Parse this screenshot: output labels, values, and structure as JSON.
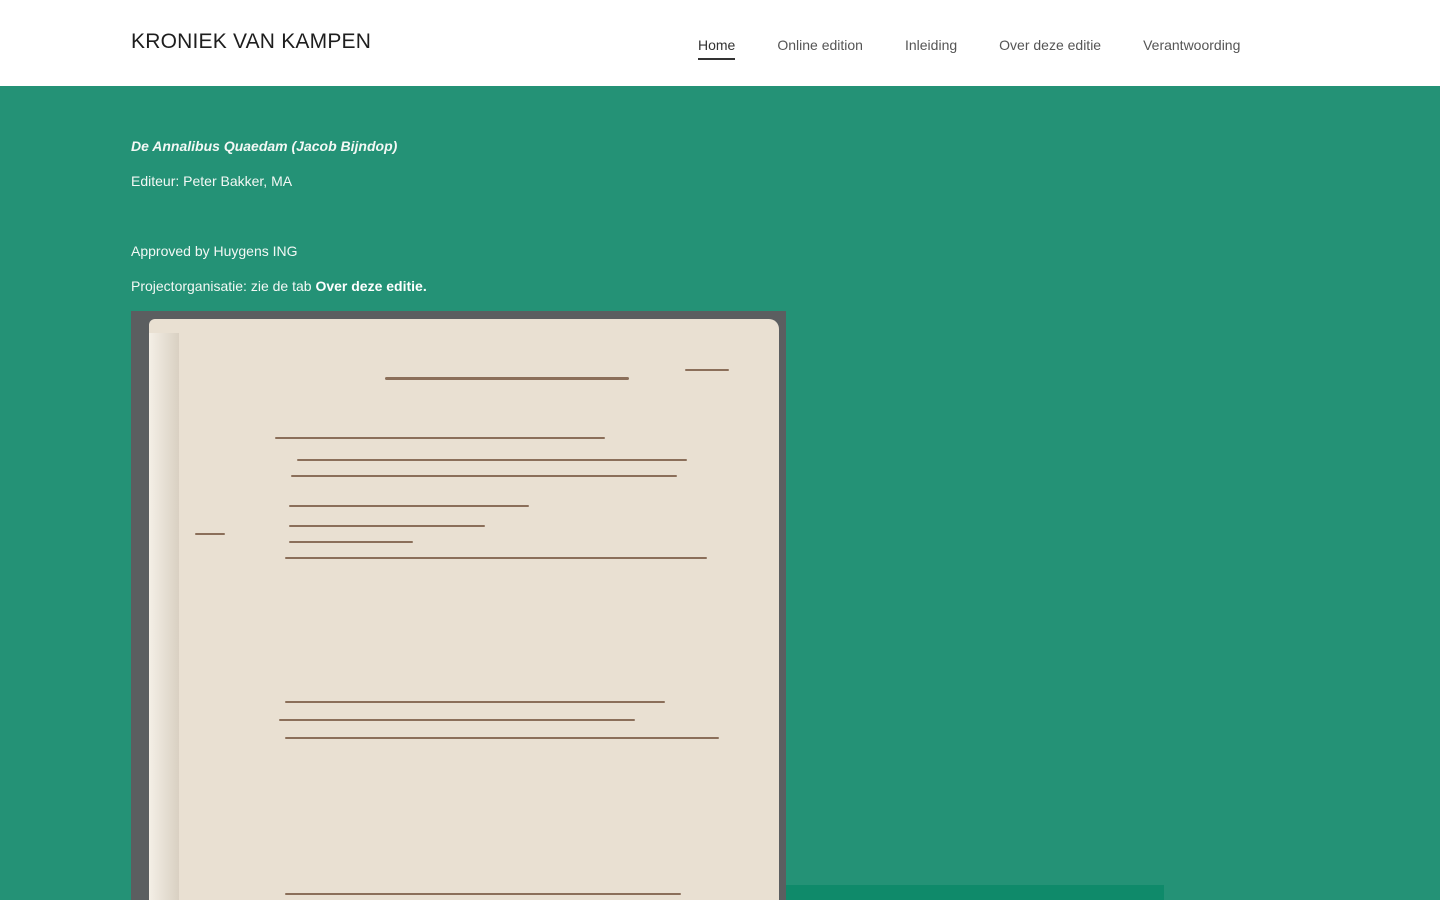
{
  "header": {
    "site_title": "KRONIEK VAN KAMPEN",
    "nav": [
      {
        "label": "Home",
        "active": true
      },
      {
        "label": "Online edition",
        "active": false
      },
      {
        "label": "Inleiding",
        "active": false
      },
      {
        "label": "Over deze editie",
        "active": false
      },
      {
        "label": "Verantwoording",
        "active": false
      }
    ]
  },
  "main": {
    "work_title": "De Annalibus Quaedam (Jacob Bijndop)",
    "editor": "Editeur: Peter Bakker, MA",
    "approved": "Approved by Huygens ING",
    "project_prefix": "Projectorganisatie: zie de tab ",
    "project_link": "Over deze editie."
  },
  "colors": {
    "background": "#249276",
    "header_bg": "#ffffff",
    "manuscript_paper": "#e9e0d2"
  },
  "icons": {
    "manuscript_image": "manuscript-photo"
  }
}
